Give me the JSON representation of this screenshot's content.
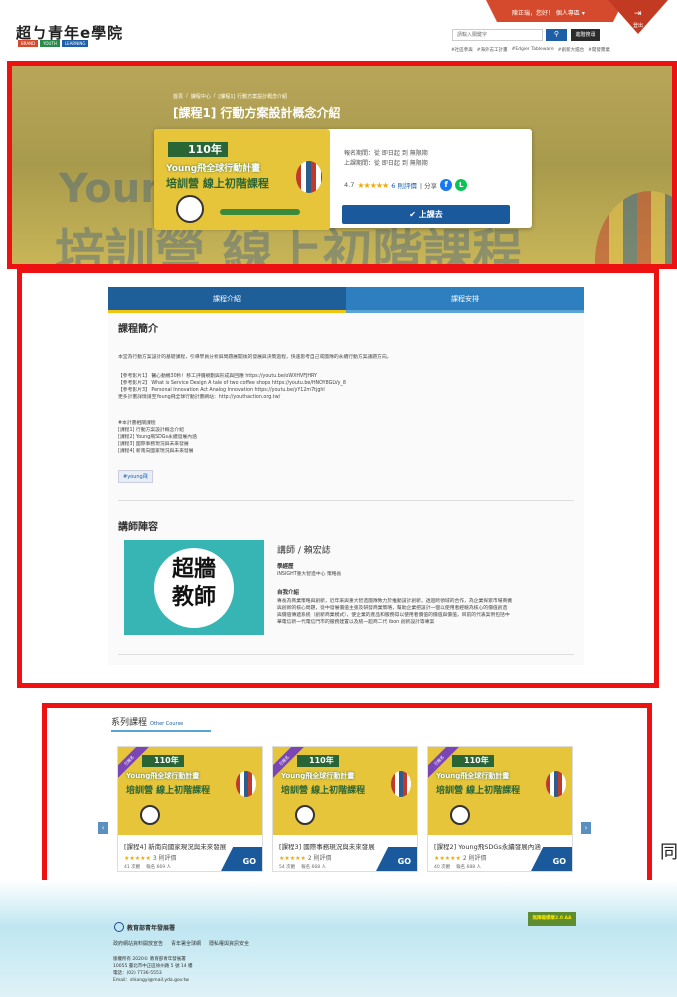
{
  "header": {
    "logo_text": "超ㄅ青年e學院",
    "logo_sub_tags": [
      "BRAND",
      "YOUTH",
      "LEARNING"
    ],
    "user_greeting": "陳正瑞，您好！ 個人專區 ▾",
    "logout_label": "登出",
    "search_placeholder": "請輸入關鍵字",
    "search_button_icon": "search-icon",
    "advanced_search_label": "進階搜尋",
    "hot_tags": [
      "#社區參與",
      "#海外志工計畫",
      "#Edgier Tableware",
      "#創新大擂台",
      "#開發實業"
    ]
  },
  "course": {
    "breadcrumb": [
      "首頁",
      "/",
      "課程中心",
      "/",
      "[課程1] 行動方案設計概念介紹"
    ],
    "title": "[課程1] 行動方案設計概念介紹",
    "poster": {
      "year": "110年",
      "line1": "Young飛全球行動計畫",
      "line2": "培訓營 線上初階課程"
    },
    "signup_period": "報名期間：從 即日起 到 無限期",
    "class_period": "上課期間：從 即日起 到 無限期",
    "rating_value": "4.7",
    "stars": "★★★★★",
    "review_count": "6 則評價",
    "share_label": "| 分享",
    "enter_button": "✔ 上課去"
  },
  "tabs": {
    "intro": "課程介紹",
    "schedule": "課程安排"
  },
  "intro": {
    "heading": "課程簡介",
    "paragraph": "本堂為行動方案設計的基礎課程，引導學員分析與問題展開後的發展與決策過程，快速思考自己或團隊的永續行動方案議題方向。",
    "refs": [
      "【參考影片1】 醫心動機30秒！移工評價規劃與形成與回應 https://youtu.be/oWXHVFJHRY",
      "【參考影片2】 What is Service Design A tale of two coffee shops https://youtu.be/HNOY8GLVy_8",
      "【參考影片3】 Personal Innovation Act Analog Innovation https://youtu.be/yY12m7tjghl",
      "更多計畫詳情請至Young飛全球行動計畫網站：http://youthaction.org.tw/"
    ],
    "plan_lines": [
      "#本計畫相關課程",
      "[課程1] 行動方案設計概念介紹",
      "[課程2] Young飛SDGs永續發展內涵",
      "[課程3] 國際事務現況與未來發展",
      "[課程4] 新南向國家現況與未來發展"
    ],
    "tag": "#young飛"
  },
  "teacher": {
    "heading": "講師陣容",
    "photo_text": "超牆教師",
    "name": "講師 / 賴宏誌",
    "exp_label": "學經歷",
    "exp_value": "iNSIGHT重大智造中心 策略長",
    "bio_label": "自我介紹",
    "bio_lines": [
      "專長為商業策略與創新，近年來與重大智造團隊致力於推動設計創新，透過跨領域的合作，為企業探索市場商機",
      "與創新的核心問題，從中發展價值主張及研發商業策略，幫助企業把設計一個以使用者經驗為核心的價值創造",
      "與價值傳遞系統（創新商業模式），使企業的產品和服務得以使用者價值的價值與價值，目前的代表案例包括中",
      "華電信新一代電信門市的服務建置以及統一超商二代 ibon 創新設計等專案"
    ]
  },
  "series": {
    "title": "系列課程",
    "subtitle": "Other Course",
    "cards": [
      {
        "ribbon": "已報名",
        "year": "110年",
        "line1": "Young飛全球行動計畫",
        "line2": "培訓營 線上初階課程",
        "title": "[課程4] 新南向國家現況與未來發展",
        "stars": "★★★★★",
        "reviews": "3 則評價",
        "meta": "41 次觀 　報名 669 人",
        "go": "GO"
      },
      {
        "ribbon": "已報名",
        "year": "110年",
        "line1": "Young飛全球行動計畫",
        "line2": "培訓營 線上初階課程",
        "title": "[課程3] 國際事務現況與未來發展",
        "stars": "★★★★★",
        "reviews": "2 則評價",
        "meta": "54 次觀 　報名 668 人",
        "go": "GO"
      },
      {
        "ribbon": "已報名",
        "year": "110年",
        "line1": "Young飛全球行動計畫",
        "line2": "培訓營 線上初階課程",
        "title": "[課程2] Young飛SDGs永續發展內涵",
        "stars": "★★★★★",
        "reviews": "2 則評價",
        "meta": "40 次觀 　報名 688 人",
        "go": "GO"
      }
    ],
    "prev_icon": "‹",
    "next_icon": "›",
    "side_glyph": "同"
  },
  "footer": {
    "org_name": "教育部青年發展署",
    "links": [
      "政府網站資料開放宣告",
      "青年署全球網",
      "隱私權與資訊安全"
    ],
    "info_lines": [
      "版權所有 2020© 教育部青年發展署",
      "10055 臺北市中正區徐州路 5 號 14 樓",
      "電話：(02) 7736-5553",
      "Email：shiangyi@mail.yda.gov.tw"
    ],
    "a11y_badge": "無障礙標章2.0 AA"
  },
  "colors": {
    "brand_blue": "#1a5a9c",
    "header_red": "#d54a2c",
    "highlight_red": "#ee1111",
    "tab_yellow": "#f1c40f",
    "star_gold": "#f2a900"
  }
}
